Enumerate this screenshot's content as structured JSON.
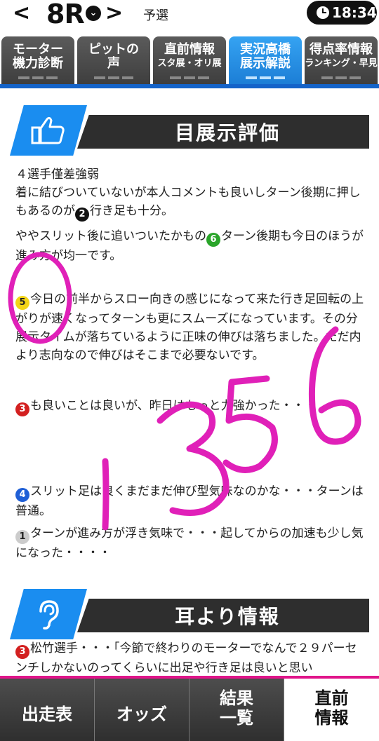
{
  "header": {
    "prev": "<",
    "race": "8R",
    "dropdown": "⌄",
    "next": ">",
    "stage": "予選",
    "time": "18:34"
  },
  "tabs": [
    {
      "l1": "モーター",
      "l2": "機力診断",
      "active": false
    },
    {
      "l1": "ピットの",
      "l2": "声",
      "active": false
    },
    {
      "l1": "直前情報",
      "l2": "スタ展・オリ展",
      "active": false
    },
    {
      "l1": "実況高橋",
      "l2": "展示解説",
      "active": true
    },
    {
      "l1": "得点率情報",
      "l2": "ランキング・早見",
      "active": false
    }
  ],
  "section1": {
    "title": "目展示評価",
    "icon": "thumbs-up-icon",
    "p1": "４選手僅差強弱",
    "p2": "着に結びついていないが本人コメントも良いしターン後期に押しもあるのが",
    "p2b": "行き足も十分。",
    "p3": "ややスリット後に追いついたかもの",
    "p3b": "ターン後期も今日のほうが進み方が均一です。",
    "p4b": "今日の前半からスロー向きの感じになって来た行き足回転の上がりが速くなってターンも更にスムーズになっています。その分展示タイムが落ちているように正味の伸びは落ちました。ただ内より志向なので伸びはそこまで必要ないです。",
    "p5b": "も良いことは良いが、昨日はもっと力強かった・・・",
    "p6b": "スリット足は良くまだまだ伸び型気味なのかな・・・ターンは普通。",
    "p7b": "ターンが進み方が浮き気味で・・・起してからの加速も少し気になった・・・・"
  },
  "section2": {
    "title": "耳より情報",
    "icon": "ear-icon",
    "p1b": "松竹選手・・・「今節で終わりのモーターでなんで２９パーセンチしかないのってくらいに出足や行き足は良いと思い"
  },
  "handwriting": {
    "numbers": "1356",
    "circle": "0"
  },
  "bottom_nav": [
    {
      "l1": "出走表"
    },
    {
      "l1": "オッズ"
    },
    {
      "l1": "結果",
      "l2": "一覧"
    },
    {
      "l1": "直前",
      "l2": "情報"
    }
  ],
  "colors": {
    "accent": "#1463c9",
    "tab_active": "#1c7ed6",
    "bottom_bar": "#e0158a",
    "marker": "#e020b8"
  }
}
